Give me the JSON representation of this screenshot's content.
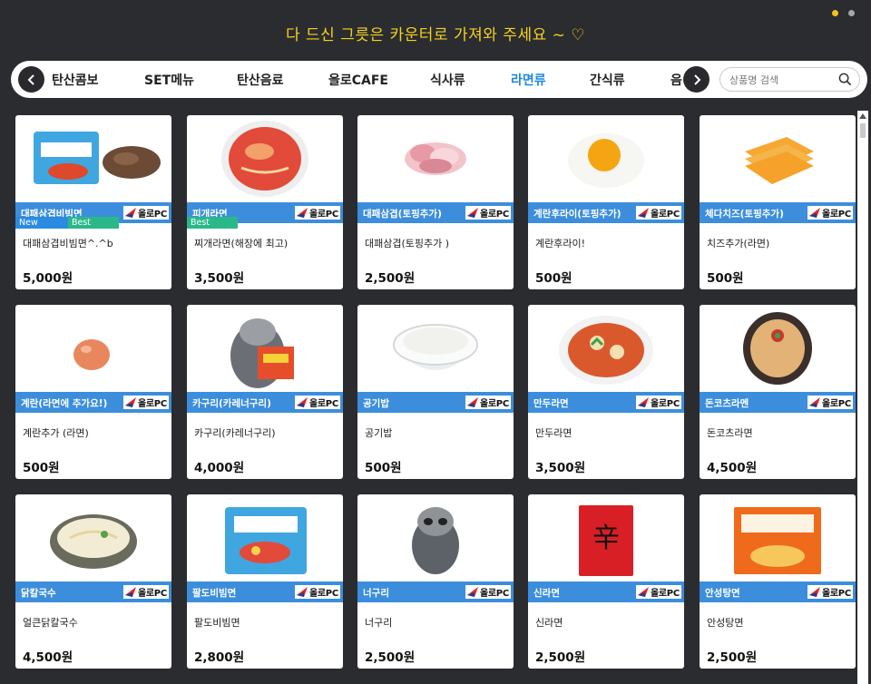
{
  "banner": {
    "message": "다 드신 그릇은 카운터로 가져와 주세요 ~ ♡"
  },
  "nav": {
    "tabs": [
      {
        "label": "탄산콤보"
      },
      {
        "label": "SET메뉴"
      },
      {
        "label": "탄산음료"
      },
      {
        "label": "올로CAFE"
      },
      {
        "label": "식사류"
      },
      {
        "label": "라면류",
        "active": true
      },
      {
        "label": "간식류"
      },
      {
        "label": "음"
      }
    ],
    "prev_icon": "chevron-left-icon",
    "next_icon": "chevron-right-icon"
  },
  "search": {
    "placeholder": "상품명 검색",
    "icon": "search-icon"
  },
  "brand": {
    "logo_text": "올로PC",
    "accent": "#3c8edc",
    "banner_color": "#f3d21c"
  },
  "products": [
    {
      "label": "대패삼겹비빔면",
      "name": "대패삼겹비빔면^.^b",
      "price": "5,000원",
      "image": "bibimmyeon-pork-photo",
      "badges": [
        "New",
        "Best"
      ]
    },
    {
      "label": "피개라면",
      "name": "찌개라면(해장에 최고)",
      "price": "3,500원",
      "image": "red-ramen-bowl-photo",
      "badges": [
        "Best"
      ]
    },
    {
      "label": "대패삼겹(토핑추가)",
      "name": "대패삼겹(토핑추가 )",
      "price": "2,500원",
      "image": "pork-slices-photo",
      "badges": []
    },
    {
      "label": "계란후라이(토핑추가)",
      "name": "계란후라이!",
      "price": "500원",
      "image": "fried-egg-photo",
      "badges": []
    },
    {
      "label": "체다치즈(토핑추가)",
      "name": "치즈추가(라면)",
      "price": "500원",
      "image": "cheese-slices-photo",
      "badges": []
    },
    {
      "label": "계란(라면에 추가요!)",
      "name": "계란추가 (라면)",
      "price": "500원",
      "image": "egg-photo",
      "badges": []
    },
    {
      "label": "카구리(카레너구리)",
      "name": "카구리(카레너구리)",
      "price": "4,000원",
      "image": "raccoon-ramen-photo",
      "badges": []
    },
    {
      "label": "공기밥",
      "name": "공기밥",
      "price": "500원",
      "image": "rice-bowl-photo",
      "badges": []
    },
    {
      "label": "만두라면",
      "name": "만두라면",
      "price": "3,500원",
      "image": "dumpling-ramen-photo",
      "badges": []
    },
    {
      "label": "돈코츠라멘",
      "name": "돈코츠라면",
      "price": "4,500원",
      "image": "tonkotsu-ramen-photo",
      "badges": []
    },
    {
      "label": "닭칼국수",
      "name": "얼큰닭칼국수",
      "price": "4,500원",
      "image": "kalguksu-photo",
      "badges": []
    },
    {
      "label": "팔도비빔면",
      "name": "팔도비빔면",
      "price": "2,800원",
      "image": "paldo-bibimmyeon-photo",
      "badges": []
    },
    {
      "label": "너구리",
      "name": "너구리",
      "price": "2,500원",
      "image": "raccoon-photo",
      "badges": []
    },
    {
      "label": "신라면",
      "name": "신라면",
      "price": "2,500원",
      "image": "shin-ramyun-photo",
      "badges": []
    },
    {
      "label": "안성탕면",
      "name": "안성탕면",
      "price": "2,500원",
      "image": "ansungtangmyun-photo",
      "badges": []
    }
  ]
}
